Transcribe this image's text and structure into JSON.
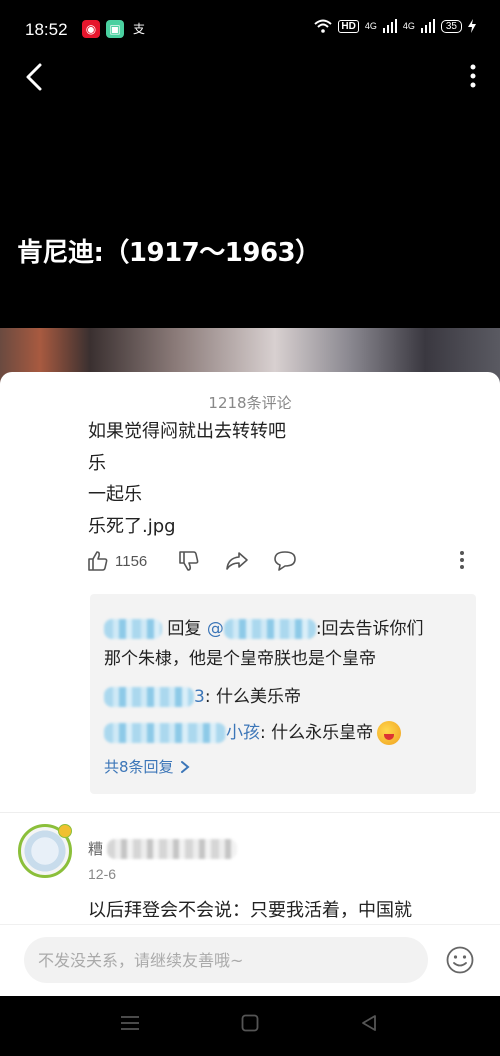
{
  "status_bar": {
    "time": "18:52",
    "apps": [
      {
        "icon": "weibo-icon",
        "color": "#e6162d",
        "glyph": "◉"
      },
      {
        "icon": "app-icon",
        "color": "#4ad0a0",
        "glyph": "▣"
      },
      {
        "icon": "alipay-icon",
        "color": "#1677ff",
        "glyph": "支"
      }
    ],
    "hd": "HD",
    "network_1": "4G",
    "network_2": "4G",
    "battery": "35"
  },
  "video": {
    "title": "肯尼迪:（1917～1963）"
  },
  "comments": {
    "count_label": "1218条评论",
    "first": {
      "lines": [
        "如果觉得闷就出去转转吧",
        "乐",
        "一起乐",
        "乐死了.jpg"
      ],
      "likes": "1156",
      "replies": {
        "r1_action": "回复",
        "r1_mention_prefix": "@",
        "r1_text_a": ":回去告诉你们",
        "r1_text_b": "那个朱棣，他是个皇帝朕也是个皇帝",
        "r2_suffix": "3",
        "r2_text": ": 什么美乐帝",
        "r3_suffix": "小孩",
        "r3_text": ": 什么永乐皇帝",
        "view_all": "共8条回复"
      }
    },
    "second": {
      "name_prefix": "糟",
      "date": "12-6",
      "text": "以后拜登会不会说：只要我活着，中国就"
    }
  },
  "input": {
    "placeholder": "不发没关系，请继续友善哦~"
  },
  "colors": {
    "accent_link": "#3c76b8",
    "sheet_bg": "#ffffff",
    "reply_bg": "#f3f3f3"
  }
}
